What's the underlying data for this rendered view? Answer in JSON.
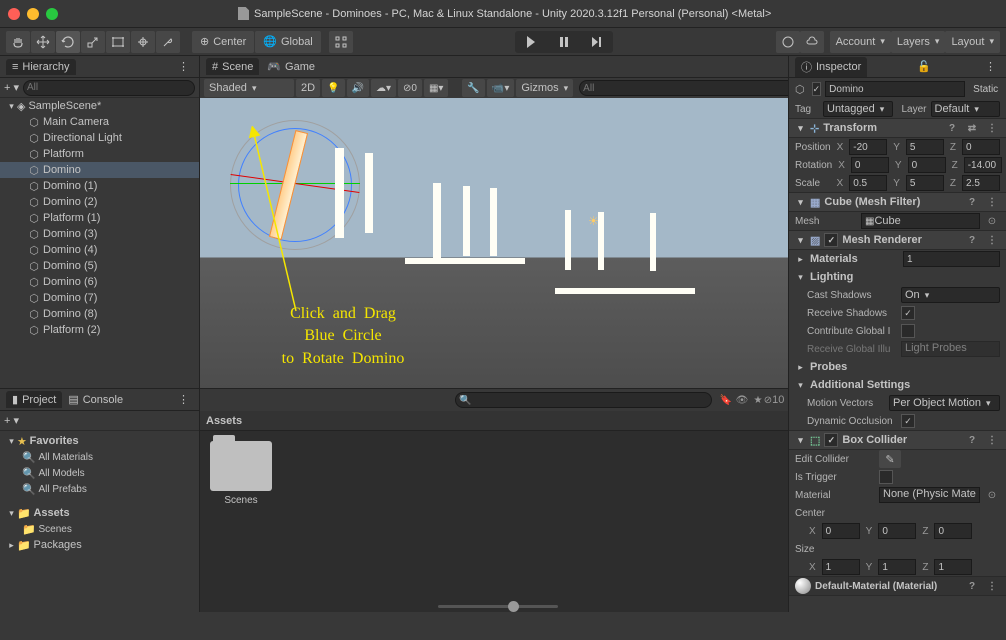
{
  "title": "SampleScene - Dominoes - PC, Mac & Linux Standalone - Unity 2020.3.12f1 Personal (Personal) <Metal>",
  "toolbar": {
    "pivot": "Center",
    "handle": "Global",
    "account": "Account",
    "layers": "Layers",
    "layout": "Layout"
  },
  "hierarchy": {
    "title": "Hierarchy",
    "search_ph": "All",
    "scene": "SampleScene*",
    "items": [
      "Main Camera",
      "Directional Light",
      "Platform",
      "Domino",
      "Domino (1)",
      "Domino (2)",
      "Platform (1)",
      "Domino (3)",
      "Domino (4)",
      "Domino (5)",
      "Domino (6)",
      "Domino (7)",
      "Domino (8)",
      "Platform (2)"
    ],
    "selected_index": 3
  },
  "scene_tabs": {
    "scene": "Scene",
    "game": "Game"
  },
  "scene_toolbar": {
    "shading": "Shaded",
    "twod": "2D",
    "gizmos": "Gizmos",
    "search_ph": "All"
  },
  "annotation": "Click and Drag\nBlue Circle\nto Rotate Domino",
  "inspector": {
    "title": "Inspector",
    "name": "Domino",
    "static": "Static",
    "tag_lbl": "Tag",
    "tag_val": "Untagged",
    "layer_lbl": "Layer",
    "layer_val": "Default",
    "transform": {
      "title": "Transform",
      "pos_lbl": "Position",
      "px": "-20",
      "py": "5",
      "pz": "0",
      "rot_lbl": "Rotation",
      "rx": "0",
      "ry": "0",
      "rz": "-14.00",
      "scl_lbl": "Scale",
      "sx": "0.5",
      "sy": "5",
      "sz": "2.5"
    },
    "meshfilter": {
      "title": "Cube (Mesh Filter)",
      "mesh_lbl": "Mesh",
      "mesh_val": "Cube"
    },
    "renderer": {
      "title": "Mesh Renderer",
      "materials": "Materials",
      "mat_count": "1",
      "lighting": "Lighting",
      "cast_lbl": "Cast Shadows",
      "cast_val": "On",
      "recv_lbl": "Receive Shadows",
      "contrib_lbl": "Contribute Global I",
      "recvgi_lbl": "Receive Global Illu",
      "recvgi_val": "Light Probes",
      "probes": "Probes",
      "addl": "Additional Settings",
      "motion_lbl": "Motion Vectors",
      "motion_val": "Per Object Motion",
      "dyn_lbl": "Dynamic Occlusion"
    },
    "collider": {
      "title": "Box Collider",
      "edit_lbl": "Edit Collider",
      "trigger_lbl": "Is Trigger",
      "mat_lbl": "Material",
      "mat_val": "None (Physic Mate",
      "center_lbl": "Center",
      "cx": "0",
      "cy": "0",
      "cz": "0",
      "size_lbl": "Size",
      "sx": "1",
      "sy": "1",
      "sz": "1"
    },
    "material": "Default-Material (Material)"
  },
  "project": {
    "tab_project": "Project",
    "tab_console": "Console",
    "favorites": "Favorites",
    "fav_items": [
      "All Materials",
      "All Models",
      "All Prefabs"
    ],
    "assets": "Assets",
    "asset_items": [
      "Scenes"
    ],
    "packages": "Packages",
    "breadcrumb": "Assets",
    "folder": "Scenes",
    "count": "10"
  }
}
